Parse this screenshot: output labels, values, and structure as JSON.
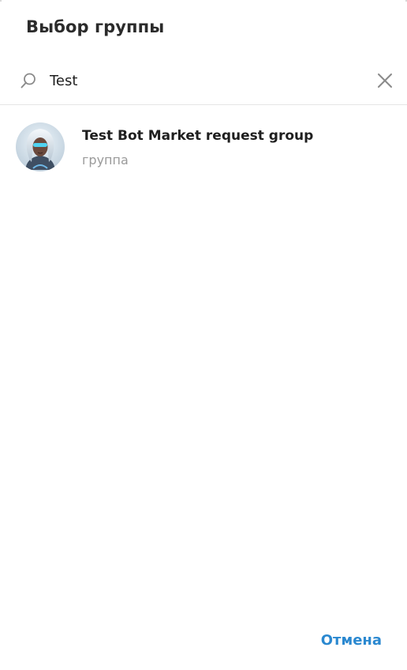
{
  "dialog": {
    "title": "Выбор группы",
    "cancel_label": "Отмена"
  },
  "search": {
    "value": "Test",
    "icon": "search-icon",
    "clear_icon": "close-icon"
  },
  "results": [
    {
      "title": "Test Bot Market request group",
      "subtitle": "группа",
      "avatar": "avatar-robot-girl"
    }
  ],
  "colors": {
    "accent": "#2a88d0",
    "title_text": "#2b2b2b",
    "secondary_text": "#9a9a9a",
    "divider": "#e6e6e6"
  }
}
